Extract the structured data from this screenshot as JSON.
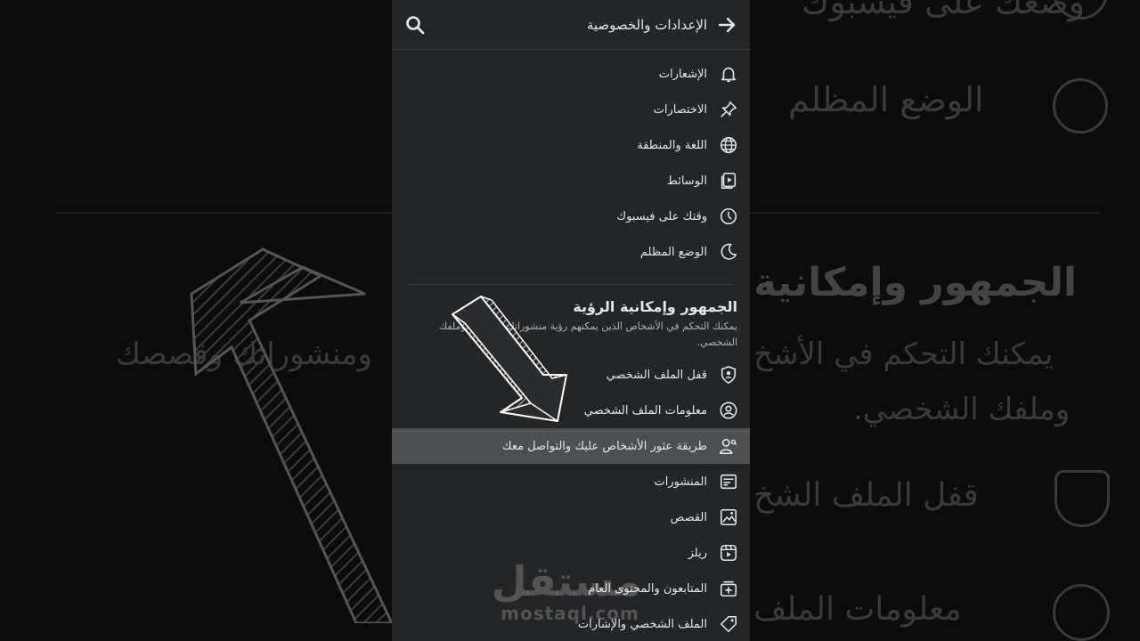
{
  "header": {
    "title": "الإعدادات والخصوصية"
  },
  "menu_top": [
    {
      "label": "الإشعارات",
      "icon": "bell-icon"
    },
    {
      "label": "الاختصارات",
      "icon": "pin-icon"
    },
    {
      "label": "اللغة والمنطقة",
      "icon": "globe-icon"
    },
    {
      "label": "الوسائط",
      "icon": "media-icon"
    },
    {
      "label": "وقتك على فيسبوك",
      "icon": "clock-icon"
    },
    {
      "label": "الوضع المظلم",
      "icon": "moon-icon"
    }
  ],
  "section": {
    "title": "الجمهور وإمكانية الرؤية",
    "description": "يمكنك التحكم في الأشخاص الذين يمكنهم رؤية منشوراتك وقصصك وملفك الشخصي."
  },
  "menu_audience": [
    {
      "label": "قفل الملف الشخصي",
      "icon": "shield-user-icon"
    },
    {
      "label": "معلومات الملف الشخصي",
      "icon": "user-circle-icon"
    },
    {
      "label": "طريقة عثور الأشخاص عليك والتواصل معك",
      "icon": "user-search-icon",
      "active": true
    },
    {
      "label": "المنشورات",
      "icon": "posts-icon"
    },
    {
      "label": "القصص",
      "icon": "stories-icon"
    },
    {
      "label": "ريلز",
      "icon": "reels-icon"
    },
    {
      "label": "المتابعون والمحتوى العام",
      "icon": "followers-icon"
    },
    {
      "label": "الملف الشخصي والإشارات",
      "icon": "tag-icon"
    }
  ],
  "background": {
    "dark_mode": "الوضع المظلم",
    "section_title": "الجمهور وإمكانية",
    "desc_line1": "يمكنك التحكم في الأشخ",
    "desc_line2": "ومنشوراتك وقصصك",
    "desc_line3": "وملفك الشخصي.",
    "lock": "قفل الملف الشخ",
    "info": "معلومات الملف"
  },
  "watermark": {
    "arabic": "مستقل",
    "latin": "mostaql.com"
  },
  "colors": {
    "panel": "#242526",
    "active_row": "#4e4f50",
    "text": "#e4e6eb",
    "muted": "#b0b3b8"
  }
}
